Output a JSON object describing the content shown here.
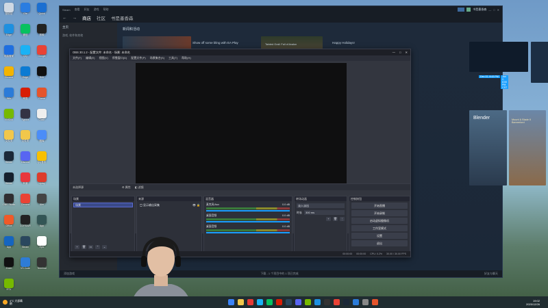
{
  "desktop_icons": [
    {
      "label": "回收站",
      "color": "#cfd8e3"
    },
    {
      "label": "Gfe",
      "color": "#2a7de1"
    },
    {
      "label": "Quick",
      "color": "#1b6fd1"
    },
    {
      "label": "Edge",
      "color": "#1e90e0"
    },
    {
      "label": "微信",
      "color": "#07c160"
    },
    {
      "label": "剪映",
      "color": "#222"
    },
    {
      "label": "电脑管家",
      "color": "#1e6fe0"
    },
    {
      "label": "QQ",
      "color": "#1ab2f5"
    },
    {
      "label": "Google",
      "color": "#e94235"
    },
    {
      "label": "Chrome",
      "color": "#f4b400"
    },
    {
      "label": "Edge",
      "color": "#0c7bd3"
    },
    {
      "label": "Hub",
      "color": "#111"
    },
    {
      "label": "Win",
      "color": "#2b7bd8"
    },
    {
      "label": "网易",
      "color": "#d81e06"
    },
    {
      "label": "Game",
      "color": "#e5542b"
    },
    {
      "label": "NVIDIA",
      "color": "#76b900"
    },
    {
      "label": "Typora",
      "color": "#334"
    },
    {
      "label": "Clash",
      "color": "#eee"
    },
    {
      "label": "文件夹",
      "color": "#f1c74b"
    },
    {
      "label": "文件夹",
      "color": "#f1c74b"
    },
    {
      "label": "图库",
      "color": "#4b8df8"
    },
    {
      "label": "Steam",
      "color": "#1b2838"
    },
    {
      "label": "Discord",
      "color": "#5865f2"
    },
    {
      "label": "QQ音乐",
      "color": "#f7c000"
    },
    {
      "label": "Steam",
      "color": "#16202d"
    },
    {
      "label": "有道",
      "color": "#e8373d"
    },
    {
      "label": "Uplay",
      "color": "#dd3c2c"
    },
    {
      "label": "OBS Studio",
      "color": "#302e31"
    },
    {
      "label": "Chrome",
      "color": "#ea4335"
    },
    {
      "label": "Aim",
      "color": "#444"
    },
    {
      "label": "Office",
      "color": "#f05a28"
    },
    {
      "label": "CORSAIR",
      "color": "#222"
    },
    {
      "label": "App",
      "color": "#355"
    },
    {
      "label": "App",
      "color": "#1565c0"
    },
    {
      "label": "Steam",
      "color": "#2a475e"
    },
    {
      "label": "Epic",
      "color": "#fff"
    },
    {
      "label": "Zoom",
      "color": "#111"
    },
    {
      "label": "VS Code",
      "color": "#2e7cd6"
    },
    {
      "label": "Terminal",
      "color": "#333"
    },
    {
      "label": "RTX",
      "color": "#76b900"
    }
  ],
  "steam": {
    "window_title": "Steam",
    "top_menu": [
      "Steam",
      "查看",
      "好友",
      "游戏",
      "帮助"
    ],
    "nav": [
      "商店",
      "社区",
      "书是墨香森"
    ],
    "user": "书是墨香森",
    "sidebar_header": "主页",
    "sidebar_filter": "游戏, 软件和其他",
    "section_title": "新闻和活动",
    "cards": [
      {
        "label": "Show off some bling with EA Play"
      },
      {
        "label": "Tainted Grail: Fall of Avalon"
      },
      {
        "label": "Happy Holidays!"
      }
    ],
    "badges": [
      "Dec 22, 8:43 PM",
      "Jan 2, 8:00 PM CST"
    ],
    "right_caption": "Blender",
    "game_caption": "Mount & Blade II Bannerlord",
    "bottom_left": "添加游戏",
    "bottom_center": "下载 - 1 个项目中的 1 项已完成",
    "bottom_right": "好友与聊天"
  },
  "obs": {
    "title": "OBS 30.1.2 - 配置文件: 未命名 - 场景: 未命名",
    "menu": [
      "文件(F)",
      "编辑(E)",
      "视图(V)",
      "停靠窗口(D)",
      "配置文件(P)",
      "场景集合(S)",
      "工具(T)",
      "帮助(H)"
    ],
    "source_bar": [
      "未选择源",
      "属性",
      "滤镜"
    ],
    "docks": {
      "scenes": {
        "title": "场景",
        "item": "场景"
      },
      "sources": {
        "title": "来源",
        "item": "显示输出采集"
      },
      "mixer": {
        "title": "混音器",
        "channels": [
          {
            "name": "麦克风/Aux",
            "db": "0.0 dB"
          },
          {
            "name": "桌面音频",
            "db": "0.0 dB"
          },
          {
            "name": "桌面音频",
            "db": "0.0 dB"
          }
        ]
      },
      "transitions": {
        "title": "转场动画",
        "type": "淡入淡出",
        "duration_label": "时长",
        "duration": "300 ms"
      },
      "controls": {
        "title": "控制按钮",
        "buttons": [
          "开始直播",
          "开始录制",
          "启动虚拟摄像机",
          "工作室模式",
          "设置",
          "退出"
        ]
      }
    },
    "status": [
      "CPU: 0.2%",
      "30.00 / 30.00 FPS",
      "00:00:00",
      "00:00:00"
    ]
  },
  "taskbar": {
    "weather": "4°C 大部晴朗",
    "time": "19:02",
    "date": "2025/12/26"
  },
  "colors": {
    "steam_bg": "#1b2838",
    "obs_bg": "#272a33",
    "accent": "#1a9fff"
  }
}
